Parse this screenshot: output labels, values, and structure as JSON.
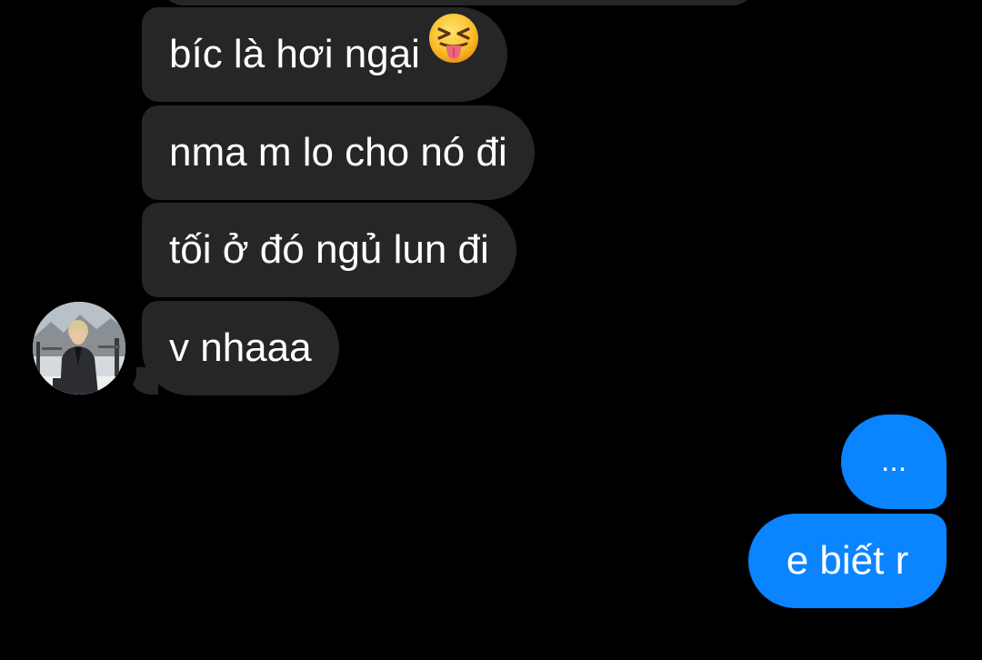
{
  "conversation": {
    "received": [
      {
        "text": "bíc là hơi ngại",
        "emoji": "squinting-face-with-tongue"
      },
      {
        "text": "nma m lo cho nó đi"
      },
      {
        "text": "tối ở đó ngủ lun đi"
      },
      {
        "text": "v nhaaa"
      }
    ],
    "sent": [
      {
        "text": "..."
      },
      {
        "text": "e biết r"
      }
    ]
  },
  "colors": {
    "background": "#000000",
    "received_bubble": "#262628",
    "sent_bubble": "#0a84ff",
    "text": "#ffffff"
  },
  "avatar": {
    "icon": "contact-avatar-photo"
  }
}
